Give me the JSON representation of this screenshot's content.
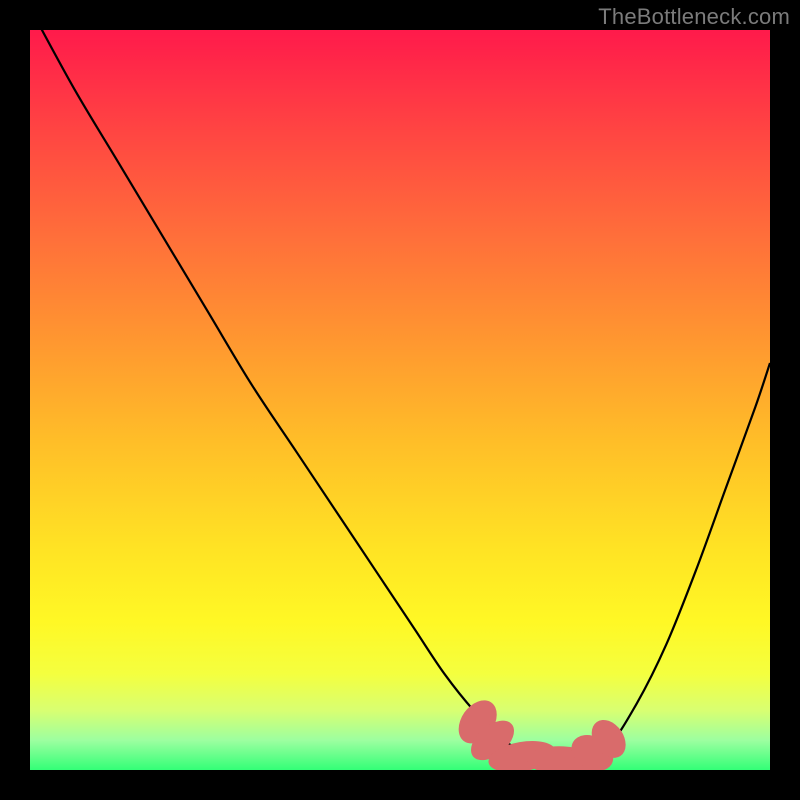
{
  "attribution": "TheBottleneck.com",
  "colors": {
    "gradient": [
      "#ff1a4b",
      "#ff4642",
      "#ff6f3a",
      "#ff9730",
      "#ffbf28",
      "#ffe324",
      "#fff825",
      "#f4ff3f",
      "#d8ff72",
      "#9cffa0",
      "#33ff77"
    ],
    "marker": "#d96b6b",
    "curve": "#000000"
  },
  "chart_data": {
    "type": "line",
    "title": "",
    "xlabel": "",
    "ylabel": "",
    "xlim": [
      0,
      100
    ],
    "ylim": [
      0,
      100
    ],
    "series": [
      {
        "name": "bottleneck-curve",
        "x": [
          0,
          6,
          12,
          18,
          24,
          30,
          36,
          42,
          48,
          52,
          56,
          60,
          64,
          68,
          72,
          74,
          78,
          82,
          86,
          90,
          94,
          98,
          100
        ],
        "values": [
          103,
          92,
          82,
          72,
          62,
          52,
          43,
          34,
          25,
          19,
          13,
          8,
          4,
          2,
          1,
          1,
          3,
          9,
          17,
          27,
          38,
          49,
          55
        ]
      }
    ],
    "markers": {
      "name": "optimal-range",
      "points": [
        {
          "x": 60.5,
          "y": 6.5,
          "rx": 3.2,
          "ry": 2.2,
          "rot": -55
        },
        {
          "x": 62.5,
          "y": 4.0,
          "rx": 3.4,
          "ry": 2.0,
          "rot": -40
        },
        {
          "x": 66.5,
          "y": 1.8,
          "rx": 4.6,
          "ry": 2.0,
          "rot": -10
        },
        {
          "x": 72.0,
          "y": 1.2,
          "rx": 4.8,
          "ry": 2.0,
          "rot": 3
        },
        {
          "x": 76.0,
          "y": 2.3,
          "rx": 3.0,
          "ry": 2.2,
          "rot": 30
        },
        {
          "x": 78.2,
          "y": 4.2,
          "rx": 2.8,
          "ry": 2.0,
          "rot": 55
        }
      ]
    }
  }
}
